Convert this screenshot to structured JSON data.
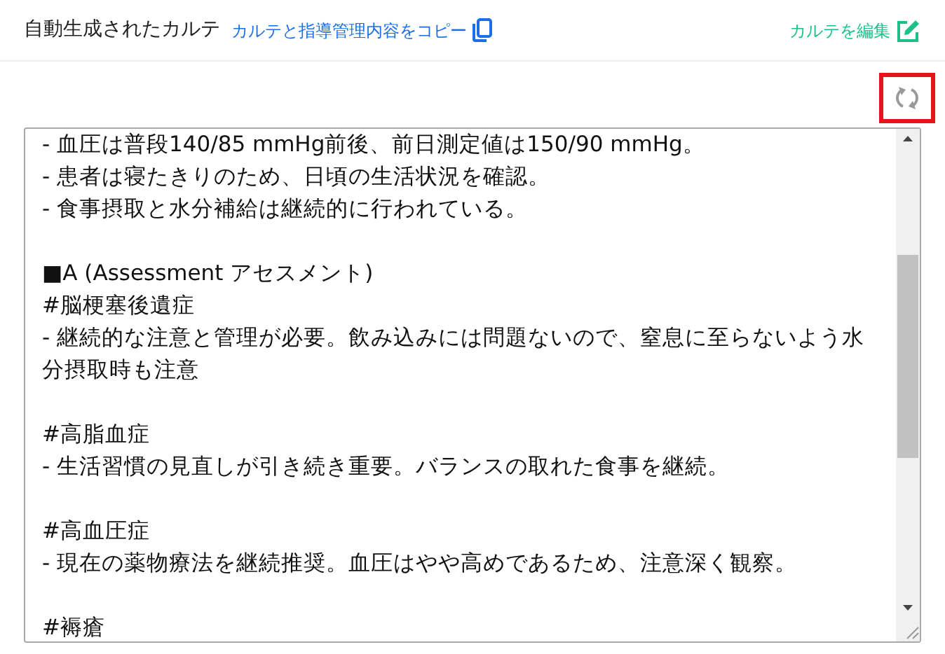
{
  "header": {
    "title": "自動生成されたカルテ",
    "copy_link": "カルテと指導管理内容をコピー",
    "edit_link": "カルテを編集"
  },
  "refresh_button": {
    "highlighted": true
  },
  "note": {
    "blocks": [
      {
        "lines": [
          "- 血圧は普段140/85 mmHg前後、前日測定値は150/90 mmHg。",
          "- 患者は寝たきりのため、日頃の生活状況を確認。",
          "- 食事摂取と水分補給は継続的に行われている。"
        ]
      },
      {
        "lines": [
          "■A (Assessment アセスメント)",
          "#脳梗塞後遺症",
          "- 継続的な注意と管理が必要。飲み込みには問題ないので、窒息に至らないよう水分摂取時も注意"
        ]
      },
      {
        "lines": [
          "#高脂血症",
          "- 生活習慣の見直しが引き続き重要。バランスの取れた食事を継続。"
        ]
      },
      {
        "lines": [
          "#高血圧症",
          "- 現在の薬物療法を継続推奨。血圧はやや高めであるため、注意深く観察。"
        ]
      },
      {
        "lines": [
          "#褥瘡"
        ]
      }
    ]
  }
}
